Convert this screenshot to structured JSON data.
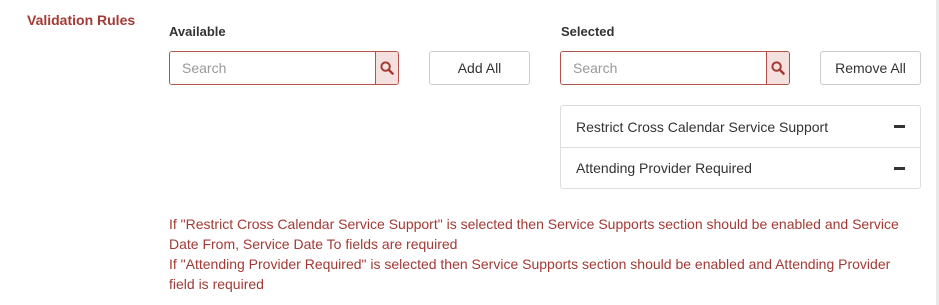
{
  "section": {
    "title": "Validation Rules"
  },
  "available": {
    "heading": "Available",
    "search_placeholder": "Search",
    "add_all_label": "Add All"
  },
  "selected": {
    "heading": "Selected",
    "search_placeholder": "Search",
    "remove_all_label": "Remove All",
    "items": [
      {
        "label": "Restrict Cross Calendar Service Support"
      },
      {
        "label": "Attending Provider Required"
      }
    ]
  },
  "notes": [
    "If \"Restrict Cross Calendar Service Support\" is selected then Service Supports section should be enabled and Service Date From, Service Date To fields are required",
    "If \"Attending Provider Required\" is selected then Service Supports section should be enabled and Attending Provider field is required"
  ],
  "icons": {
    "search": "search-icon",
    "remove": "minus-icon"
  },
  "colors": {
    "accent": "#a33a35",
    "search_button_bg": "#f4e0df",
    "border": "#cccccc"
  }
}
